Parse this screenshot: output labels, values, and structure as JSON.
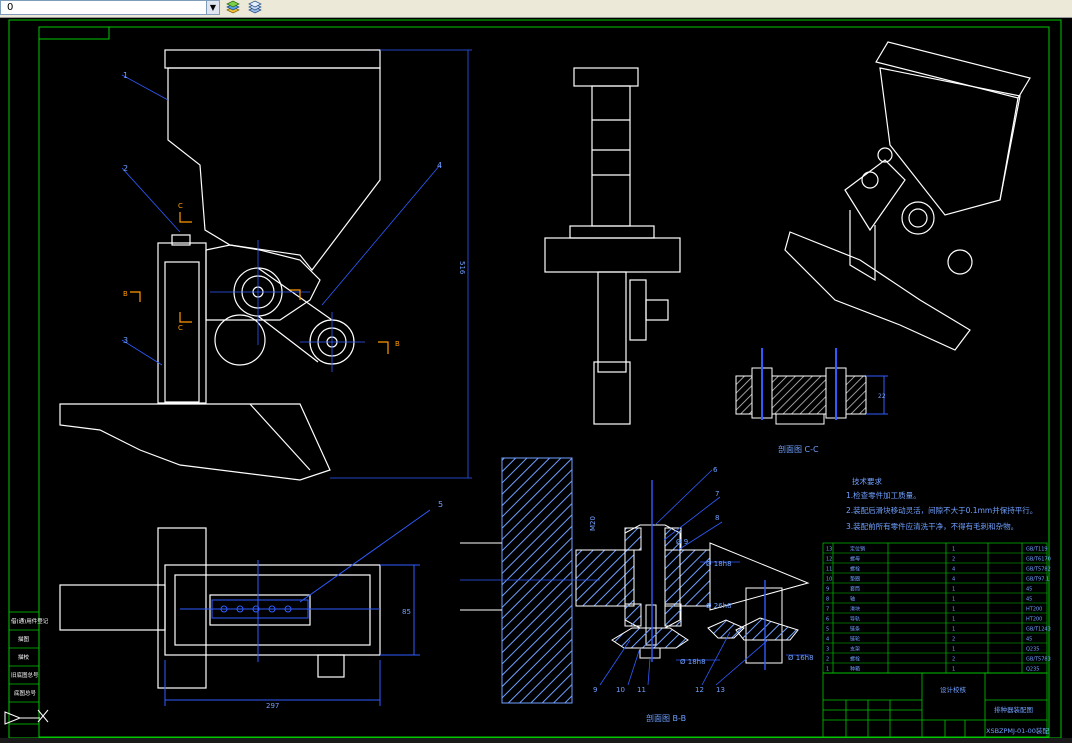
{
  "toolbar": {
    "layer_value": "0",
    "layer_bullet": "□"
  },
  "view_labels": {
    "section_cc": "剖面图 C-C",
    "section_bb": "剖面图 B-B",
    "dim_height": "516",
    "dim_width": "297",
    "dim_depth": "85",
    "dim_cc": "22",
    "dim_thread": "M20",
    "dim_diam1": "Ø 18h8",
    "dim_diam2": "Ø 18h8",
    "dim_diam3": "Ø 26h8",
    "dim_diam4": "Ø 16h8",
    "dim_top": "Ø 9"
  },
  "part_numbers": {
    "p1": "1",
    "p2": "2",
    "p3": "3",
    "p4": "4",
    "p5": "5",
    "p6": "6",
    "p7": "7",
    "p8": "8",
    "p9": "9",
    "p10": "10",
    "p11": "11",
    "p12": "12",
    "p13": "13",
    "sec_c": "C",
    "sec_b": "B"
  },
  "tech_notes": {
    "title": "技术要求",
    "line1": "1.检查零件加工质量。",
    "line2": "2.装配后滑块移动灵活，间隙不大于0.1mm并保持平行。",
    "line3": "3.装配前所有零件应清洗干净，不得有毛刺和杂物。"
  },
  "title_block": {
    "drawing_name": "排种器装配图",
    "company": "设计校核",
    "drawing_code": "XSBZPMJ-01-00装配",
    "left_stamps": [
      "借(通)用件登记",
      "描图",
      "描校",
      "旧底图总号",
      "底图总号"
    ]
  },
  "bom": {
    "rows": [
      [
        "13",
        "定位销",
        "1",
        "GB/T119"
      ],
      [
        "12",
        "螺母",
        "2",
        "GB/T6170"
      ],
      [
        "11",
        "螺栓",
        "4",
        "GB/T5782"
      ],
      [
        "10",
        "垫圈",
        "4",
        "GB/T97.1"
      ],
      [
        "9",
        "套筒",
        "1",
        "45"
      ],
      [
        "8",
        "轴",
        "1",
        "45"
      ],
      [
        "7",
        "滑块",
        "1",
        "HT200"
      ],
      [
        "6",
        "导轨",
        "1",
        "HT200"
      ],
      [
        "5",
        "链条",
        "1",
        "GB/T1243"
      ],
      [
        "4",
        "链轮",
        "2",
        "45"
      ],
      [
        "3",
        "支架",
        "1",
        "Q235"
      ],
      [
        "2",
        "螺栓",
        "2",
        "GB/T5783"
      ],
      [
        "1",
        "种箱",
        "1",
        "Q235"
      ]
    ]
  },
  "colors": {
    "frame_green": "#00c800",
    "line_white": "#ffffff",
    "dim_blue": "#2f5cff",
    "cut_orange": "#ff9900",
    "hatch_blue": "#6fa0ff"
  }
}
